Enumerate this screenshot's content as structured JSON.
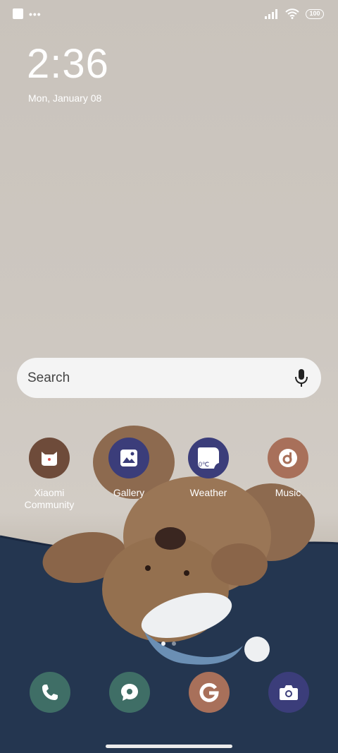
{
  "status_bar": {
    "battery": "100",
    "icons": [
      "notification-square-icon",
      "more-dots-icon",
      "signal-icon",
      "wifi-icon",
      "battery-icon"
    ]
  },
  "lock_clock": {
    "time": "2:36",
    "date": "Mon, January 08"
  },
  "search": {
    "placeholder": "Search",
    "icon": "mic-icon"
  },
  "apps": [
    {
      "label": "Xiaomi Community",
      "icon": "xiaomi-community-icon",
      "color": "#6e4b3a"
    },
    {
      "label": "Gallery",
      "icon": "gallery-icon",
      "color": "#3b3d7a"
    },
    {
      "label": "Weather",
      "icon": "weather-icon",
      "color": "#3b3d7a",
      "badge": "0℃"
    },
    {
      "label": "Music",
      "icon": "music-icon",
      "color": "#a8705a"
    }
  ],
  "dock": [
    {
      "icon": "phone-icon",
      "color": "#3f6e66"
    },
    {
      "icon": "messages-icon",
      "color": "#3f6e66"
    },
    {
      "icon": "google-icon",
      "color": "#a8705a"
    },
    {
      "icon": "camera-icon",
      "color": "#3b3d7a"
    }
  ],
  "pager": {
    "pages": 2,
    "current": 1
  }
}
